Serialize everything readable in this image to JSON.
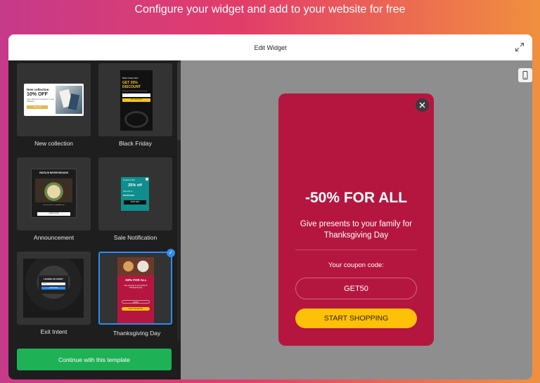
{
  "banner": {
    "text": "Configure your widget and add to your website for free"
  },
  "modal": {
    "title": "Edit Widget"
  },
  "templates": [
    {
      "label": "New collection",
      "preview": {
        "headline": "New collection",
        "offer": "10% OFF",
        "body": "Get a discount on all items in new collection",
        "button": "Shop now"
      }
    },
    {
      "label": "Black Friday",
      "preview": {
        "kicker": "Black Friday Sale!",
        "headline": "GET 30% DISCOUNT",
        "body": "Enter your e-mail to get the discount",
        "field": "E-mail",
        "button": "GET DISCOUNT"
      }
    },
    {
      "label": "Announcement",
      "preview": {
        "headline": "PASTA IS NEVER ENOUGH",
        "body": "Our new menu is available now.",
        "button": "LEARN MORE"
      }
    },
    {
      "label": "Sale Notification",
      "preview": {
        "kicker": "Weekend sale!",
        "headline": "25% off",
        "body": "Sale ends on",
        "date": "PAYDAYSON",
        "button": "SHOP NOW"
      }
    },
    {
      "label": "Exit Intent",
      "preview": {
        "headline": "LEAVING SO SOON?",
        "field": "Email",
        "button": "SUBSCRIBE"
      }
    },
    {
      "label": "Thanksgiving Day",
      "selected": true,
      "preview": {
        "headline": "-50% FOR ALL",
        "body": "Give presents to your family for Thanksgiving Day",
        "code": "GET50",
        "button": "START SHOPPING"
      }
    }
  ],
  "footer": {
    "continue_label": "Continue with this template"
  },
  "popup": {
    "title": "-50% FOR ALL",
    "subtitle": "Give presents to your family for Thanksgiving Day",
    "coupon_label": "Your coupon code:",
    "coupon_code": "GET50",
    "cta_label": "START SHOPPING"
  },
  "colors": {
    "popup_bg": "#b5163f",
    "cta_bg": "#ffc107",
    "continue_bg": "#1fb155",
    "selected_border": "#2d8cf0",
    "sidebar_bg": "#1e1e1e",
    "preview_bg": "#8e8e8e"
  },
  "icons": {
    "expand": "expand-arrows-icon",
    "device": "mobile-phone-icon",
    "close": "close-icon",
    "selected": "checkmark-icon"
  }
}
